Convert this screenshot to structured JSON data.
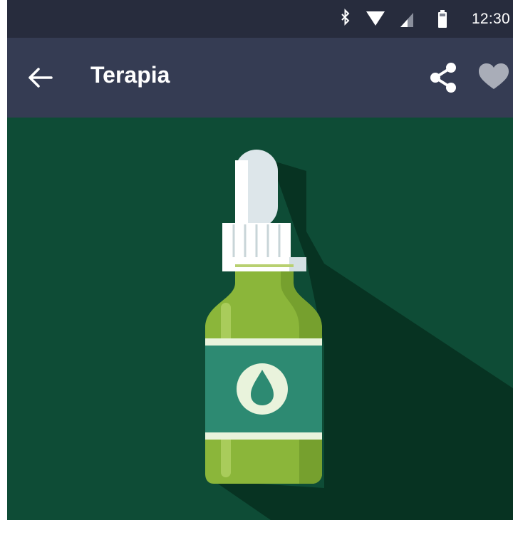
{
  "status_bar": {
    "time": "12:30",
    "icons": [
      "bluetooth-icon",
      "wifi-icon",
      "cell-signal-icon",
      "battery-icon"
    ]
  },
  "app_bar": {
    "back_icon": "arrow-left-icon",
    "title": "Terapia",
    "actions": [
      "share-icon",
      "heart-icon"
    ]
  },
  "hero": {
    "image": "essential-oil-dropper-bottle",
    "label_icon": "drop-icon"
  },
  "colors": {
    "status_bar": "#272c3d",
    "app_bar": "#353c53",
    "hero_background": "#0e4c36",
    "hero_shadow": "#073322",
    "bottle_green": "#8bb63a",
    "label_teal": "#2d8a72",
    "favorite_icon": "#a9adb8"
  }
}
